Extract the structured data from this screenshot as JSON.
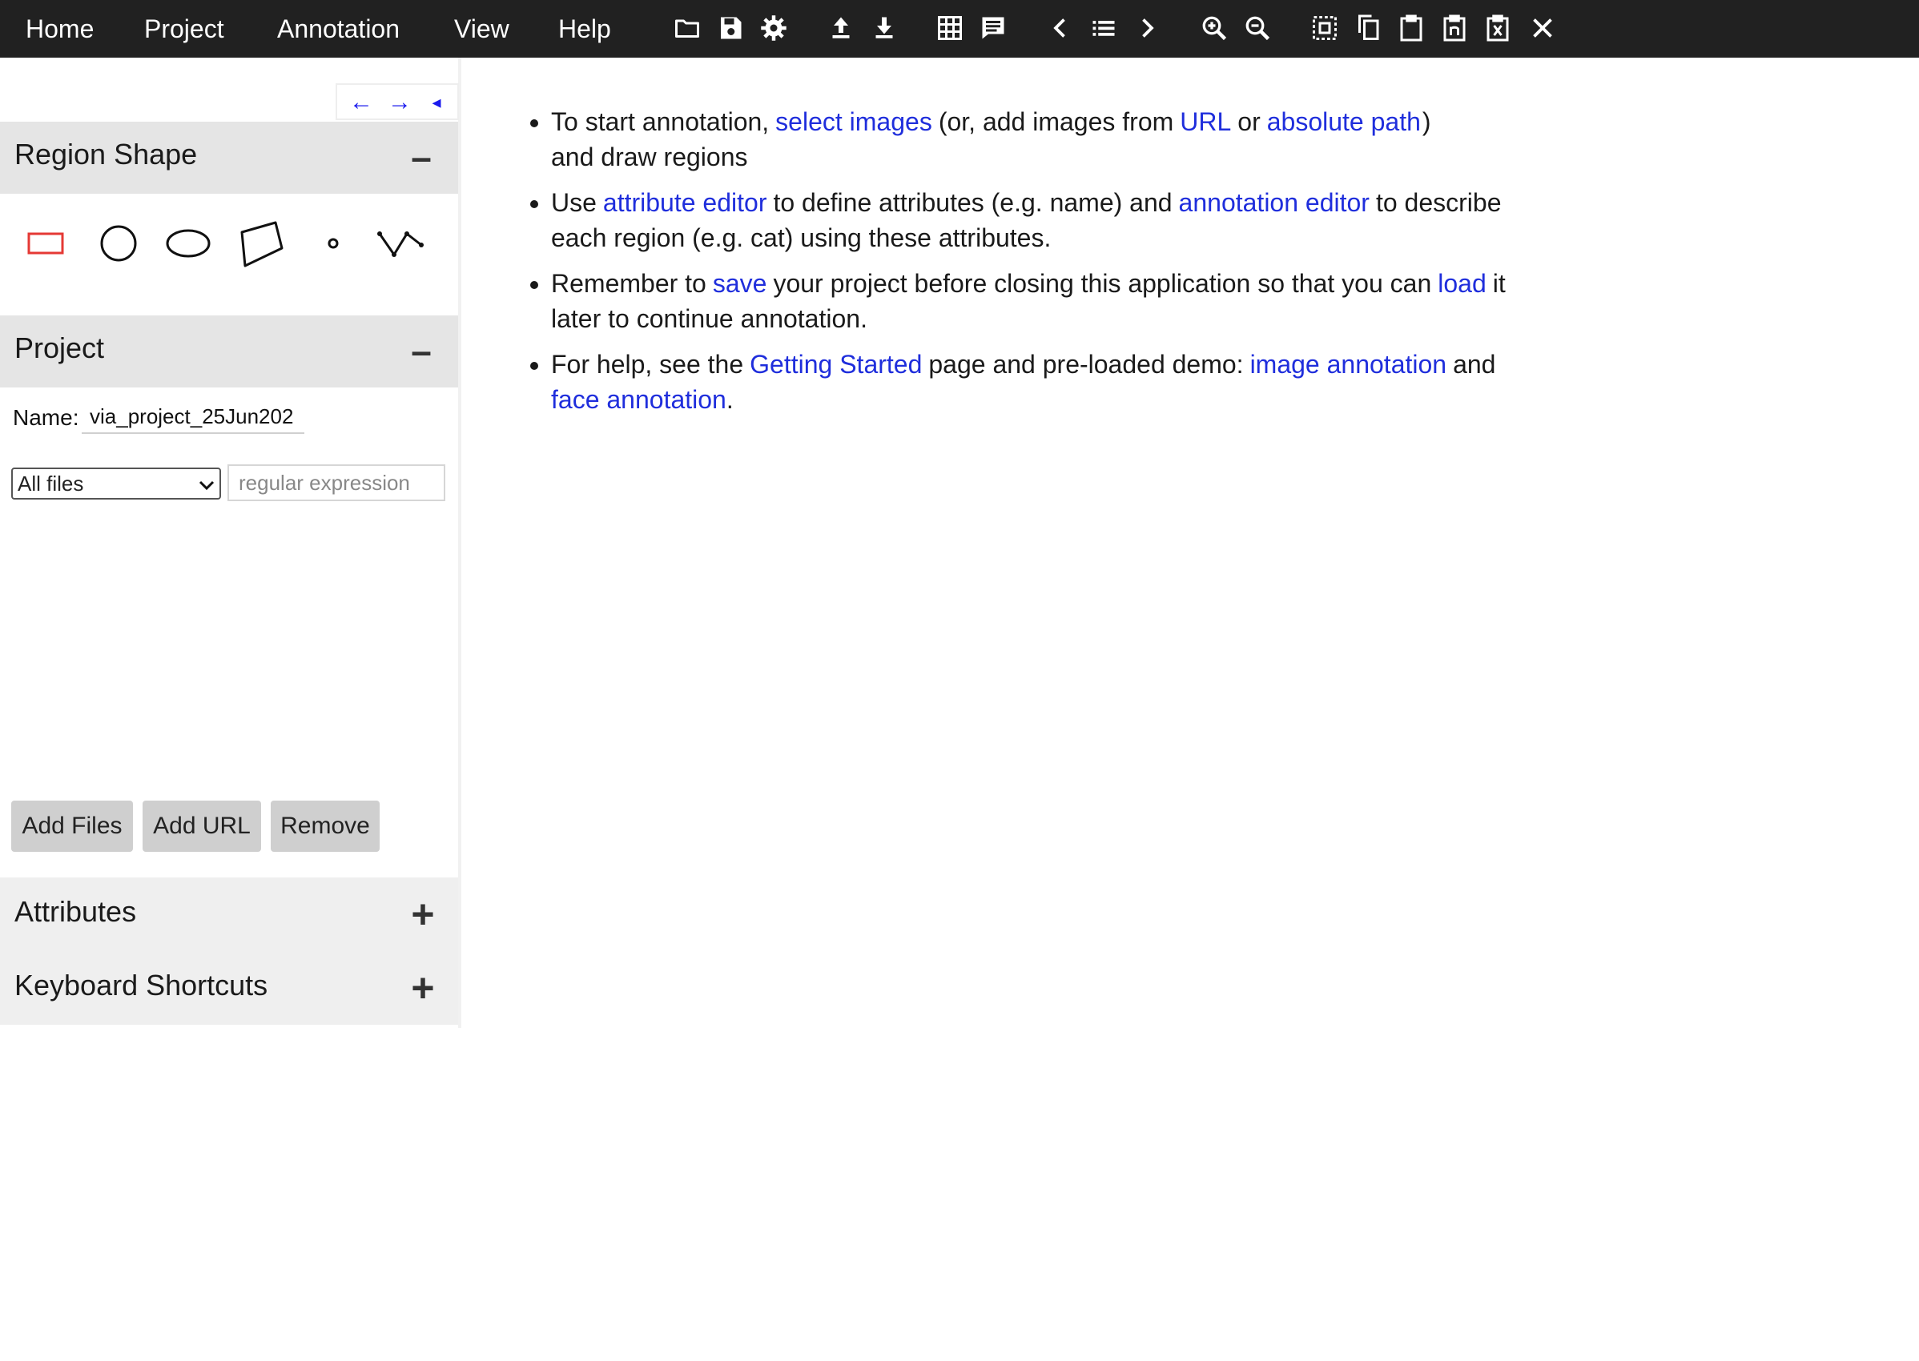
{
  "menu": {
    "home": "Home",
    "project": "Project",
    "annotation": "Annotation",
    "view": "View",
    "help": "Help"
  },
  "toolbar_icons": [
    "folder-open-icon",
    "save-icon",
    "settings-icon",
    "upload-icon",
    "download-icon",
    "grid-view-icon",
    "comment-icon",
    "prev-image-icon",
    "image-list-icon",
    "next-image-icon",
    "zoom-in-icon",
    "zoom-out-icon",
    "select-all-icon",
    "copy-icon",
    "paste-icon",
    "paste-n-icon",
    "paste-delete-icon",
    "close-icon"
  ],
  "left_panel": {
    "nav": {
      "prev": "←",
      "next": "→",
      "collapse": "◂"
    },
    "region_shape": {
      "title": "Region Shape",
      "toggle": "–",
      "shapes": [
        "rectangle",
        "circle",
        "ellipse",
        "polygon",
        "point",
        "polyline"
      ],
      "selected": "rectangle"
    },
    "project": {
      "title": "Project",
      "toggle": "–",
      "name_label": "Name:",
      "name_value": "via_project_25Jun202",
      "filter_selected": "All files",
      "regex_placeholder": "regular expression",
      "buttons": {
        "add_files": "Add Files",
        "add_url": "Add URL",
        "remove": "Remove"
      }
    },
    "attributes": {
      "title": "Attributes",
      "toggle": "+"
    },
    "keyboard_shortcuts": {
      "title": "Keyboard Shortcuts",
      "toggle": "+"
    }
  },
  "help": {
    "item1": {
      "t1": "To start annotation,",
      "link_select": "select images",
      "t2": "(or, add images from",
      "link_url": "URL",
      "t3": "or",
      "link_abs": "absolute path",
      "t4": ")",
      "t5": "and draw regions"
    },
    "item2": {
      "t1": "Use",
      "link_attr": "attribute editor",
      "t2": "to define attributes (e.g. name) and",
      "link_annot": "annotation editor",
      "t3": "to describe each region (e.g. cat) using these attributes."
    },
    "item3": {
      "t1": "Remember to",
      "link_save": "save",
      "t2": "your project before closing this application so that you can",
      "link_load": "load",
      "t3": "it later to continue annotation."
    },
    "item4": {
      "t1": "For help, see the",
      "link_getting": "Getting Started",
      "t2": "page and pre-loaded demo:",
      "link_image": "image annotation",
      "t3": "and",
      "link_face": "face annotation",
      "t4": "."
    }
  },
  "colors": {
    "topbar_bg": "#212121",
    "link": "#1f2edc",
    "selected_shape": "#e53935",
    "section_bg": "#e5e5e5",
    "button_bg": "#cfcfcf"
  }
}
